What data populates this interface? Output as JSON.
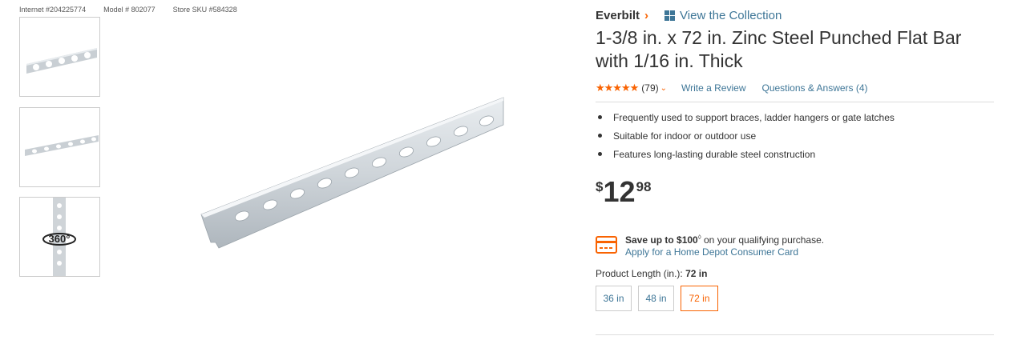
{
  "identifiers": {
    "internet": "Internet #204225774",
    "model": "Model # 802077",
    "store_sku": "Store SKU #584328"
  },
  "gallery": {
    "thumbnails": [
      {
        "icon": "flat-bar-closeup"
      },
      {
        "icon": "flat-bar-angle"
      },
      {
        "icon": "360-view",
        "label": "360°"
      }
    ]
  },
  "product": {
    "brand": "Everbilt",
    "collection_link": "View the Collection",
    "title": "1-3/8 in. x 72 in. Zinc Steel Punched Flat Bar with 1/16 in. Thick",
    "rating": {
      "stars": "★★★★★",
      "count": "(79)",
      "value": 5
    },
    "write_review": "Write a Review",
    "qa": "Questions & Answers (4)",
    "bullets": [
      "Frequently used to support braces, ladder hangers or gate latches",
      "Suitable for indoor or outdoor use",
      "Features long-lasting durable steel construction"
    ],
    "price": {
      "currency": "$",
      "dollars": "12",
      "cents": "98"
    },
    "promo": {
      "headline": "Save up to $100",
      "mark": "◊",
      "rest": " on your qualifying purchase.",
      "link": "Apply for a Home Depot Consumer Card"
    },
    "length": {
      "label": "Product Length (in.):",
      "selected": "72 in",
      "options": [
        "36 in",
        "48 in",
        "72 in"
      ]
    }
  },
  "colors": {
    "accent": "#f96302",
    "link": "#3e7697",
    "text": "#333333",
    "border": "#cccccc"
  }
}
